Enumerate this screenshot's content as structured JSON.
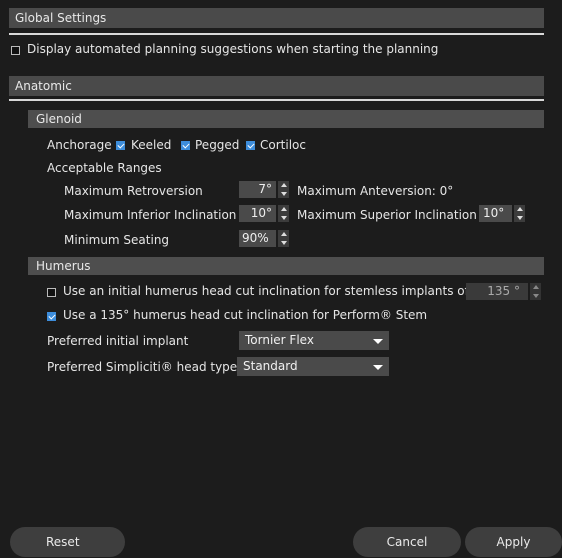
{
  "global_settings": {
    "title": "Global Settings",
    "automated_suggestions_label": "Display automated planning suggestions when starting the planning",
    "automated_suggestions_checked": false
  },
  "anatomic": {
    "title": "Anatomic",
    "glenoid": {
      "title": "Glenoid",
      "anchorage_label": "Anchorage",
      "options": [
        {
          "label": "Keeled",
          "checked": true
        },
        {
          "label": "Pegged",
          "checked": true
        },
        {
          "label": "Cortiloc",
          "checked": true
        }
      ],
      "acceptable_ranges_label": "Acceptable Ranges",
      "max_retroversion_label": "Maximum Retroversion",
      "max_retroversion_value": "7°",
      "max_anteversion_text": "Maximum Anteversion: 0°",
      "max_inferior_inclination_label": "Maximum Inferior Inclination",
      "max_inferior_inclination_value": "10°",
      "max_superior_inclination_label": "Maximum Superior Inclination",
      "max_superior_inclination_value": "10°",
      "min_seating_label": "Minimum Seating",
      "min_seating_value": "90%"
    },
    "humerus": {
      "title": "Humerus",
      "stemless_label": "Use an initial humerus head cut inclination for stemless implants of:",
      "stemless_checked": false,
      "stemless_value": "135 °",
      "perform_label": "Use a 135° humerus head cut inclination for Perform® Stem",
      "perform_checked": true,
      "preferred_implant_label": "Preferred initial implant",
      "preferred_implant_value": "Tornier Flex",
      "preferred_head_label": "Preferred Simpliciti® head type",
      "preferred_head_value": "Standard"
    }
  },
  "footer": {
    "reset": "Reset",
    "cancel": "Cancel",
    "apply": "Apply"
  }
}
